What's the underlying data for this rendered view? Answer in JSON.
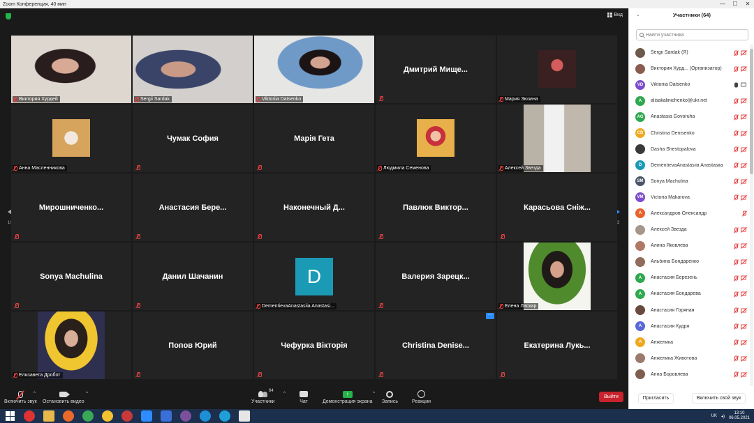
{
  "window": {
    "title": "Zoom Конференция, 40 мин"
  },
  "view": {
    "label": "Вид"
  },
  "tiles": [
    {
      "kind": "video",
      "photo": "p1",
      "label": "Виктория  Хурдей"
    },
    {
      "kind": "video",
      "photo": "p2",
      "label": "Sergii Sardak"
    },
    {
      "kind": "video",
      "photo": "p3",
      "label": "Viktoriia Datsenko",
      "active": true
    },
    {
      "kind": "name",
      "name": "Дмитрий  Мище..."
    },
    {
      "kind": "small",
      "photo": "mz",
      "label": "Мария Зюзина"
    },
    {
      "kind": "small",
      "photo": "am",
      "label": "Анна Масленникова"
    },
    {
      "kind": "name",
      "name": "Чумак София"
    },
    {
      "kind": "name",
      "name": "Марія Гета"
    },
    {
      "kind": "small",
      "photo": "ls",
      "label": "Людмила Семенова"
    },
    {
      "kind": "small",
      "photo": "az",
      "label": "Алексей Звезда"
    },
    {
      "kind": "name",
      "name": "Мирошниченко..."
    },
    {
      "kind": "name",
      "name": "Анастасия  Бере..."
    },
    {
      "kind": "name",
      "name": "Наконечный  Д..."
    },
    {
      "kind": "name",
      "name": "Павлюк  Виктор..."
    },
    {
      "kind": "name",
      "name": "Карасьова  Сніж..."
    },
    {
      "kind": "name",
      "name": "Sonya Machulina"
    },
    {
      "kind": "name",
      "name": "Данил Шачанин"
    },
    {
      "kind": "avatar",
      "letter": "D",
      "label": "DementievaAnastasiia Anastasi..."
    },
    {
      "kind": "name",
      "name": "Валерия  Зарецк..."
    },
    {
      "kind": "small",
      "photo": "el",
      "label": "Елена Ласкар"
    },
    {
      "kind": "small",
      "photo": "ed",
      "label": "Елизавета Дробот"
    },
    {
      "kind": "name",
      "name": "Попов Юрий"
    },
    {
      "kind": "name",
      "name": "Чефурка Вікторія"
    },
    {
      "kind": "name",
      "name": "Christina  Denise...",
      "dots": "···"
    },
    {
      "kind": "name",
      "name": "Екатерина  Лукь..."
    }
  ],
  "pager": {
    "left": "1/3",
    "right": "1/3"
  },
  "toolbar": {
    "mute": "Включить звук",
    "video": "Остановить видео",
    "participants": "Участники",
    "participants_count": "64",
    "chat": "Чат",
    "share": "Демонстрация экрана",
    "record": "Запись",
    "reactions": "Реакции",
    "leave": "Выйти"
  },
  "panel": {
    "title": "Участники (64)",
    "search_placeholder": "Найти участника",
    "invite": "Пригласить",
    "unmute_self": "Включить свой звук",
    "participants": [
      {
        "name": "Sergii Sardak (Я)",
        "av": "photo",
        "color": "#6d5a4d",
        "mic": "off",
        "cam": "off"
      },
      {
        "name": "Виктория  Хурд...  (Организатор)",
        "av": "photo",
        "color": "#8a5b4f",
        "mic": "off",
        "cam": "off"
      },
      {
        "name": "Viktoriia Datsenko",
        "av": "VD",
        "color": "#7c4dcc",
        "mic": "on",
        "cam": "on"
      },
      {
        "name": "alisakalinichenko@ukr.net",
        "av": "A",
        "color": "#2fa84f",
        "mic": "off",
        "cam": "off"
      },
      {
        "name": "Anastasia Govoruha",
        "av": "AG",
        "color": "#2fa84f",
        "mic": "off",
        "cam": "off"
      },
      {
        "name": "Christina Denisenko",
        "av": "CD",
        "color": "#f0a81e",
        "mic": "off",
        "cam": "off"
      },
      {
        "name": "Dasha Shestopalova",
        "av": "photo",
        "color": "#3a3a3a",
        "mic": "off",
        "cam": "off"
      },
      {
        "name": "DementievaAnastasiia Anastasiia",
        "av": "D",
        "color": "#1b9ab6",
        "mic": "off",
        "cam": "off"
      },
      {
        "name": "Sonya Machulina",
        "av": "SM",
        "color": "#4a5568",
        "mic": "off",
        "cam": "off"
      },
      {
        "name": "Victoria Makarova",
        "av": "VM",
        "color": "#7c4dcc",
        "mic": "off",
        "cam": "off"
      },
      {
        "name": "Александров Олександр",
        "av": "A",
        "color": "#e8622a",
        "mic": "off",
        "cam": "none"
      },
      {
        "name": "Алексей Звезда",
        "av": "photo",
        "color": "#a7968a",
        "mic": "off",
        "cam": "off"
      },
      {
        "name": "Алина Яковлева",
        "av": "photo",
        "color": "#b07866",
        "mic": "off",
        "cam": "off"
      },
      {
        "name": "Альбина Бондаренко",
        "av": "photo",
        "color": "#8f6c5c",
        "mic": "off",
        "cam": "off"
      },
      {
        "name": "Анастасия Березень",
        "av": "A",
        "color": "#2fa84f",
        "mic": "off",
        "cam": "off"
      },
      {
        "name": "Анастасия Бондарева",
        "av": "A",
        "color": "#2fa84f",
        "mic": "off",
        "cam": "off"
      },
      {
        "name": "Анастасия Горяная",
        "av": "photo",
        "color": "#6a4a3f",
        "mic": "off",
        "cam": "off"
      },
      {
        "name": "Анастасия Кудря",
        "av": "A",
        "color": "#5a67d8",
        "mic": "off",
        "cam": "off"
      },
      {
        "name": "Анжелика",
        "av": "A",
        "color": "#f0a81e",
        "mic": "off",
        "cam": "off"
      },
      {
        "name": "Анжелика Животова",
        "av": "photo",
        "color": "#9b7a6b",
        "mic": "off",
        "cam": "off"
      },
      {
        "name": "Анна Боровлева",
        "av": "photo",
        "color": "#7f5e50",
        "mic": "off",
        "cam": "off"
      }
    ]
  },
  "taskbar": {
    "lang": "UK",
    "time": "13:10",
    "date": "06.05.2021"
  }
}
